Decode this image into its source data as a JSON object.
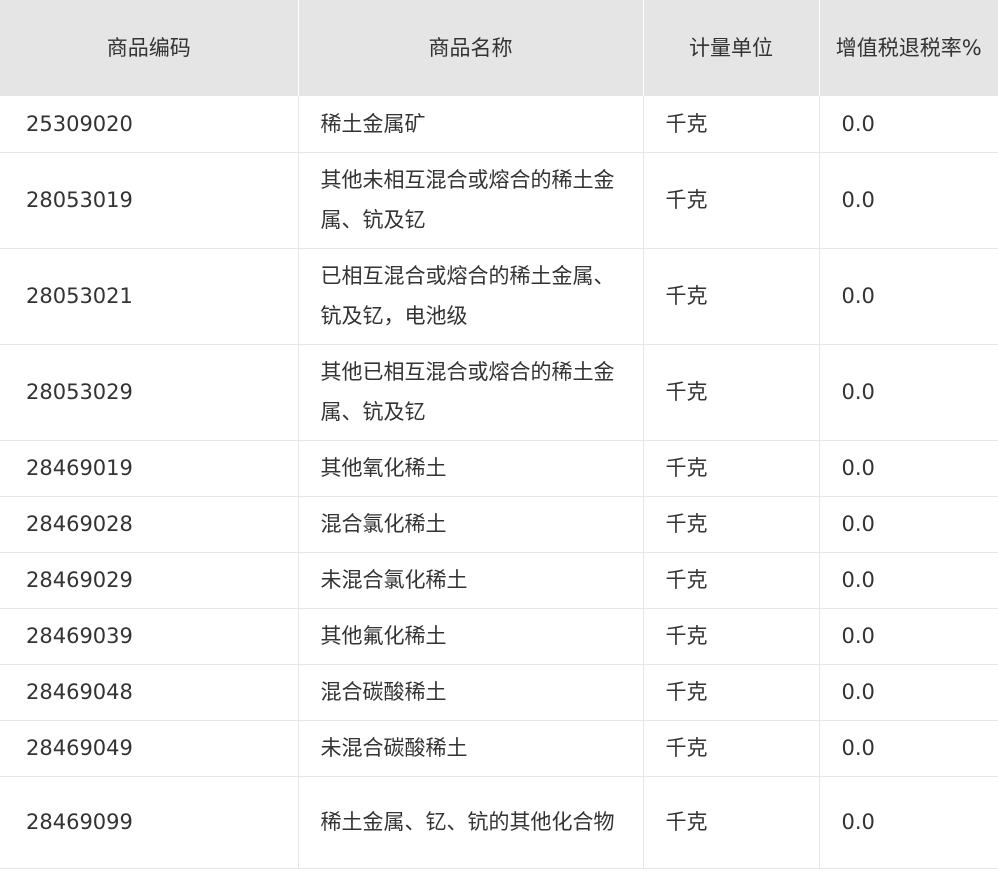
{
  "table": {
    "headers": {
      "code": "商品编码",
      "name": "商品名称",
      "unit": "计量单位",
      "rate": "增值税退税率%"
    },
    "rows": [
      {
        "code": "25309020",
        "name": "稀土金属矿",
        "unit": "千克",
        "rate": "0.0"
      },
      {
        "code": "28053019",
        "name": "其他未相互混合或熔合的稀土金属、钪及钇",
        "unit": "千克",
        "rate": "0.0"
      },
      {
        "code": "28053021",
        "name": "已相互混合或熔合的稀土金属、钪及钇，电池级",
        "unit": "千克",
        "rate": "0.0"
      },
      {
        "code": "28053029",
        "name": "其他已相互混合或熔合的稀土金属、钪及钇",
        "unit": "千克",
        "rate": "0.0"
      },
      {
        "code": "28469019",
        "name": "其他氧化稀土",
        "unit": "千克",
        "rate": "0.0"
      },
      {
        "code": "28469028",
        "name": "混合氯化稀土",
        "unit": "千克",
        "rate": "0.0"
      },
      {
        "code": "28469029",
        "name": "未混合氯化稀土",
        "unit": "千克",
        "rate": "0.0"
      },
      {
        "code": "28469039",
        "name": "其他氟化稀土",
        "unit": "千克",
        "rate": "0.0"
      },
      {
        "code": "28469048",
        "name": "混合碳酸稀土",
        "unit": "千克",
        "rate": "0.0"
      },
      {
        "code": "28469049",
        "name": "未混合碳酸稀土",
        "unit": "千克",
        "rate": "0.0"
      },
      {
        "code": "28469099",
        "name": "稀土金属、钇、钪的其他化合物",
        "unit": "千克",
        "rate": "0.0"
      }
    ]
  }
}
